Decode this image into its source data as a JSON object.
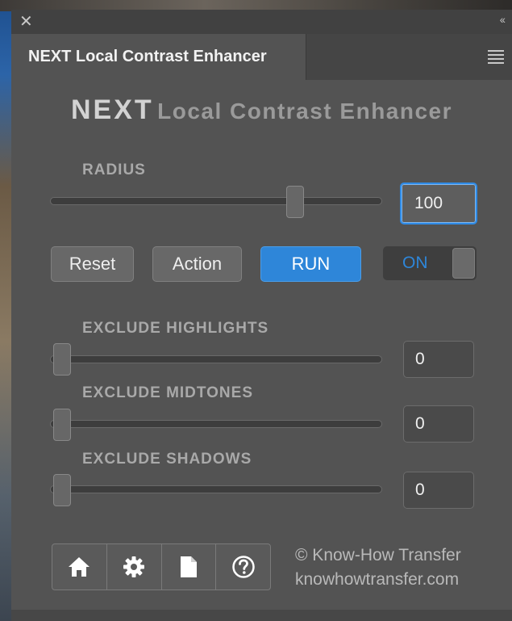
{
  "window": {
    "close_glyph": "✕",
    "collapse_glyph": "‹‹"
  },
  "tab": {
    "label": "NEXT Local Contrast Enhancer"
  },
  "heading": {
    "big": "NEXT",
    "rest": "Local Contrast Enhancer"
  },
  "radius": {
    "label": "RADIUS",
    "value": "100",
    "slider_fraction": 0.74
  },
  "buttons": {
    "reset": "Reset",
    "action": "Action",
    "run": "RUN"
  },
  "toggle": {
    "label": "ON",
    "state": "on"
  },
  "exclude": [
    {
      "label": "EXCLUDE HIGHLIGHTS",
      "value": "0",
      "slider_fraction": 0
    },
    {
      "label": "EXCLUDE MIDTONES",
      "value": "0",
      "slider_fraction": 0
    },
    {
      "label": "EXCLUDE SHADOWS",
      "value": "0",
      "slider_fraction": 0
    }
  ],
  "footer": {
    "icons": [
      "home-icon",
      "gear-icon",
      "document-icon",
      "help-icon"
    ],
    "copyright": "© Know-How Transfer",
    "website": "knowhowtransfer.com"
  },
  "colors": {
    "accent": "#2e86d9",
    "panel": "#535353"
  }
}
